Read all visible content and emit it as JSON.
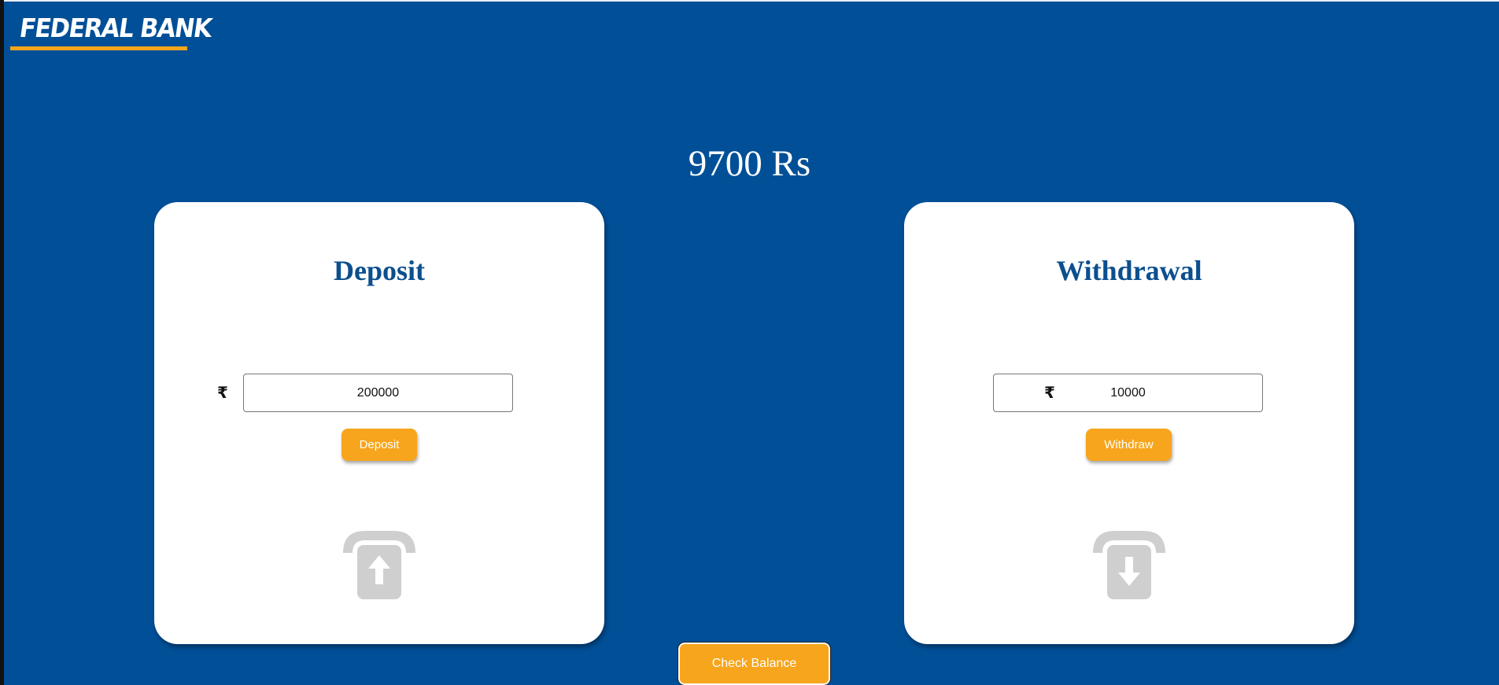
{
  "header": {
    "logo_text": "FEDERAL BANK"
  },
  "balance": {
    "text": "9700 Rs"
  },
  "deposit_card": {
    "title": "Deposit",
    "currency_symbol": "₹",
    "amount_value": "200000",
    "button_label": "Deposit",
    "icon": "atm-deposit-arrow-up-icon"
  },
  "withdraw_card": {
    "title": "Withdrawal",
    "currency_symbol": "₹",
    "amount_value": "10000",
    "button_label": "Withdraw",
    "icon": "atm-withdraw-arrow-down-icon"
  },
  "footer": {
    "check_balance_label": "Check Balance"
  },
  "colors": {
    "background": "#004f97",
    "accent": "#f7a51c",
    "card_title": "#0b4f8f",
    "icon_gray": "#cfcfcf"
  }
}
